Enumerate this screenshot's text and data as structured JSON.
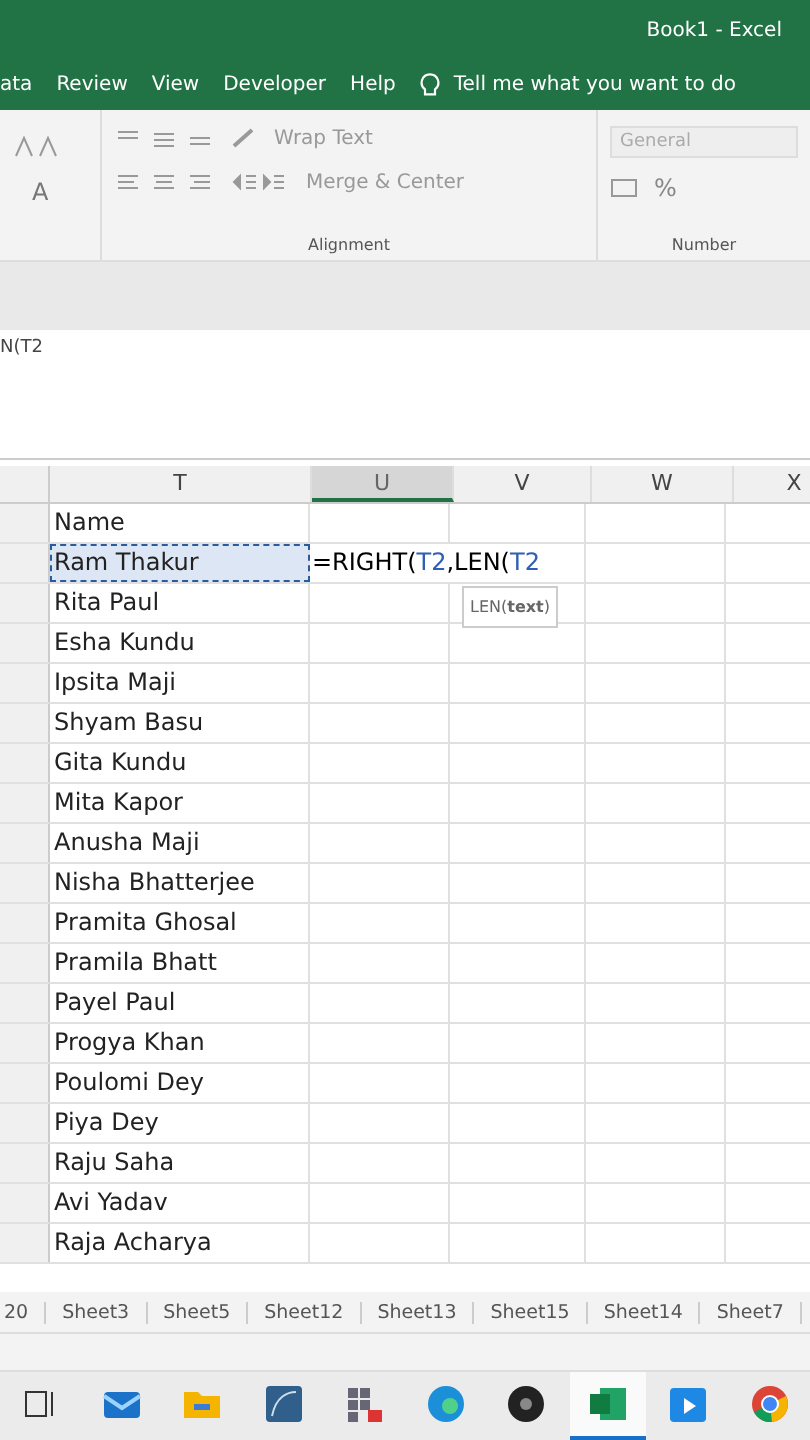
{
  "title_bar": {
    "title": "Book1  -  Excel"
  },
  "menu_tabs": [
    {
      "label": "ata"
    },
    {
      "label": "Review"
    },
    {
      "label": "View"
    },
    {
      "label": "Developer"
    },
    {
      "label": "Help"
    }
  ],
  "tell_me": {
    "placeholder": "Tell me what you want to do"
  },
  "ribbon": {
    "wrap_text": "Wrap Text",
    "merge_center": "Merge & Center",
    "font_color": "A",
    "number_format": "General",
    "percent": "%",
    "groups": [
      "Alignment",
      "Number"
    ]
  },
  "formula_bar": {
    "value": "N(T2"
  },
  "columns": [
    {
      "label": "T",
      "selected": false
    },
    {
      "label": "U",
      "selected": true
    },
    {
      "label": "V",
      "selected": false
    },
    {
      "label": "W",
      "selected": false
    },
    {
      "label": "X",
      "selected": false
    }
  ],
  "rows": [
    {
      "name": "Name",
      "marquee": false
    },
    {
      "name": "Ram Thakur",
      "marquee": true,
      "u_cell": {
        "parts": [
          {
            "text": "=RIGHT(",
            "color": "#000000"
          },
          {
            "text": "T2",
            "color": "#2f5fb3"
          },
          {
            "text": ",LEN(",
            "color": "#000000"
          },
          {
            "text": "T2",
            "color": "#2f5fb3"
          }
        ],
        "tooltip": "LEN(**text**)"
      }
    },
    {
      "name": "Rita Paul",
      "marquee": false
    },
    {
      "name": "Esha Kundu",
      "marquee": false
    },
    {
      "name": "Ipsita Maji",
      "marquee": false
    },
    {
      "name": "Shyam Basu",
      "marquee": false
    },
    {
      "name": "Gita Kundu",
      "marquee": false
    },
    {
      "name": "Mita Kapor",
      "marquee": false
    },
    {
      "name": "Anusha Maji",
      "marquee": false
    },
    {
      "name": "Nisha Bhatterjee",
      "marquee": false
    },
    {
      "name": "Pramita Ghosal",
      "marquee": false
    },
    {
      "name": "Pramila Bhatt",
      "marquee": false
    },
    {
      "name": "Payel Paul",
      "marquee": false
    },
    {
      "name": "Progya Khan",
      "marquee": false
    },
    {
      "name": "Poulomi Dey",
      "marquee": false
    },
    {
      "name": "Piya Dey",
      "marquee": false
    },
    {
      "name": "Raju Saha",
      "marquee": false
    },
    {
      "name": "Avi Yadav",
      "marquee": false
    },
    {
      "name": "Raja Acharya",
      "marquee": false
    }
  ],
  "sheet_tabs": [
    {
      "label": "20"
    },
    {
      "label": "Sheet3"
    },
    {
      "label": "Sheet5"
    },
    {
      "label": "Sheet12"
    },
    {
      "label": "Sheet13"
    },
    {
      "label": "Sheet15"
    },
    {
      "label": "Sheet14"
    },
    {
      "label": "Sheet7"
    }
  ],
  "taskbar": [
    {
      "kind": "taskview",
      "active": false
    },
    {
      "kind": "mail",
      "active": false
    },
    {
      "kind": "folder",
      "active": false
    },
    {
      "kind": "draw",
      "active": false
    },
    {
      "kind": "grid",
      "active": false
    },
    {
      "kind": "edge",
      "active": false
    },
    {
      "kind": "obs",
      "active": false
    },
    {
      "kind": "excel",
      "active": true
    },
    {
      "kind": "player",
      "active": false
    },
    {
      "kind": "chrome",
      "active": false
    }
  ]
}
